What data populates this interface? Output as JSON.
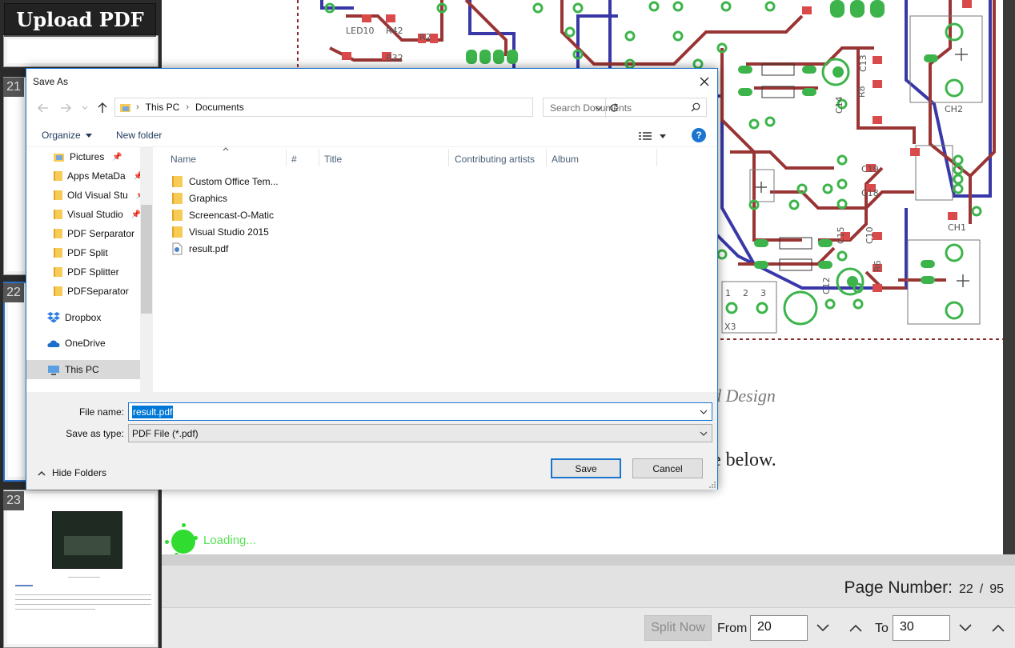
{
  "app": {
    "upload_label": "Upload PDF",
    "loading_text": "Loading..."
  },
  "thumbnails": {
    "items": [
      {
        "number": "21"
      },
      {
        "number": "22"
      },
      {
        "number": "23"
      }
    ]
  },
  "document": {
    "pcb_labels": [
      "LED10",
      "R42",
      "R2",
      "LED1",
      "R32",
      "LED1",
      "C13",
      "R8",
      "C14",
      "C19",
      "C18",
      "C15",
      "C10",
      "C12",
      "R6",
      "CH2",
      "CH1",
      "X3",
      "1",
      "2",
      "3"
    ],
    "text_line_1": "d Design",
    "text_line_2": "e below."
  },
  "page_number": {
    "label": "Page Number:",
    "current": "22",
    "separator": "/",
    "total": "95"
  },
  "split": {
    "button_label": "Split Now",
    "from_label": "From",
    "from_value": "20",
    "to_label": "To",
    "to_value": "30"
  },
  "dialog": {
    "title": "Save As",
    "breadcrumb": [
      "This PC",
      "Documents"
    ],
    "search_placeholder": "Search Documents",
    "organize_label": "Organize",
    "new_folder_label": "New folder",
    "help_label": "?",
    "nav_items": [
      {
        "label": "Pictures",
        "pinned": true,
        "icon": "pictures-icon"
      },
      {
        "label": "Apps MetaDa",
        "pinned": true,
        "icon": "folder-icon"
      },
      {
        "label": "Old Visual Stu",
        "pinned": true,
        "icon": "folder-icon"
      },
      {
        "label": "Visual Studio",
        "pinned": true,
        "icon": "folder-icon"
      },
      {
        "label": "PDF Serparator",
        "pinned": false,
        "icon": "folder-icon"
      },
      {
        "label": "PDF Split",
        "pinned": false,
        "icon": "folder-icon"
      },
      {
        "label": "PDF Splitter",
        "pinned": false,
        "icon": "folder-icon"
      },
      {
        "label": "PDFSeparator",
        "pinned": false,
        "icon": "folder-icon"
      },
      {
        "label": "Dropbox",
        "pinned": false,
        "icon": "dropbox-icon"
      },
      {
        "label": "OneDrive",
        "pinned": false,
        "icon": "onedrive-icon"
      },
      {
        "label": "This PC",
        "pinned": false,
        "icon": "computer-icon",
        "selected": true
      }
    ],
    "columns": [
      "Name",
      "#",
      "Title",
      "Contributing artists",
      "Album"
    ],
    "files": [
      {
        "name": "Custom Office Tem...",
        "type": "folder"
      },
      {
        "name": "Graphics",
        "type": "folder"
      },
      {
        "name": "Screencast-O-Matic",
        "type": "folder"
      },
      {
        "name": "Visual Studio 2015",
        "type": "folder"
      },
      {
        "name": "result.pdf",
        "type": "pdf"
      }
    ],
    "file_name_label": "File name:",
    "file_name_value": "result.pdf",
    "save_type_label": "Save as type:",
    "save_type_value": "PDF File (*.pdf)",
    "hide_folders_label": "Hide Folders",
    "save_label": "Save",
    "cancel_label": "Cancel"
  }
}
